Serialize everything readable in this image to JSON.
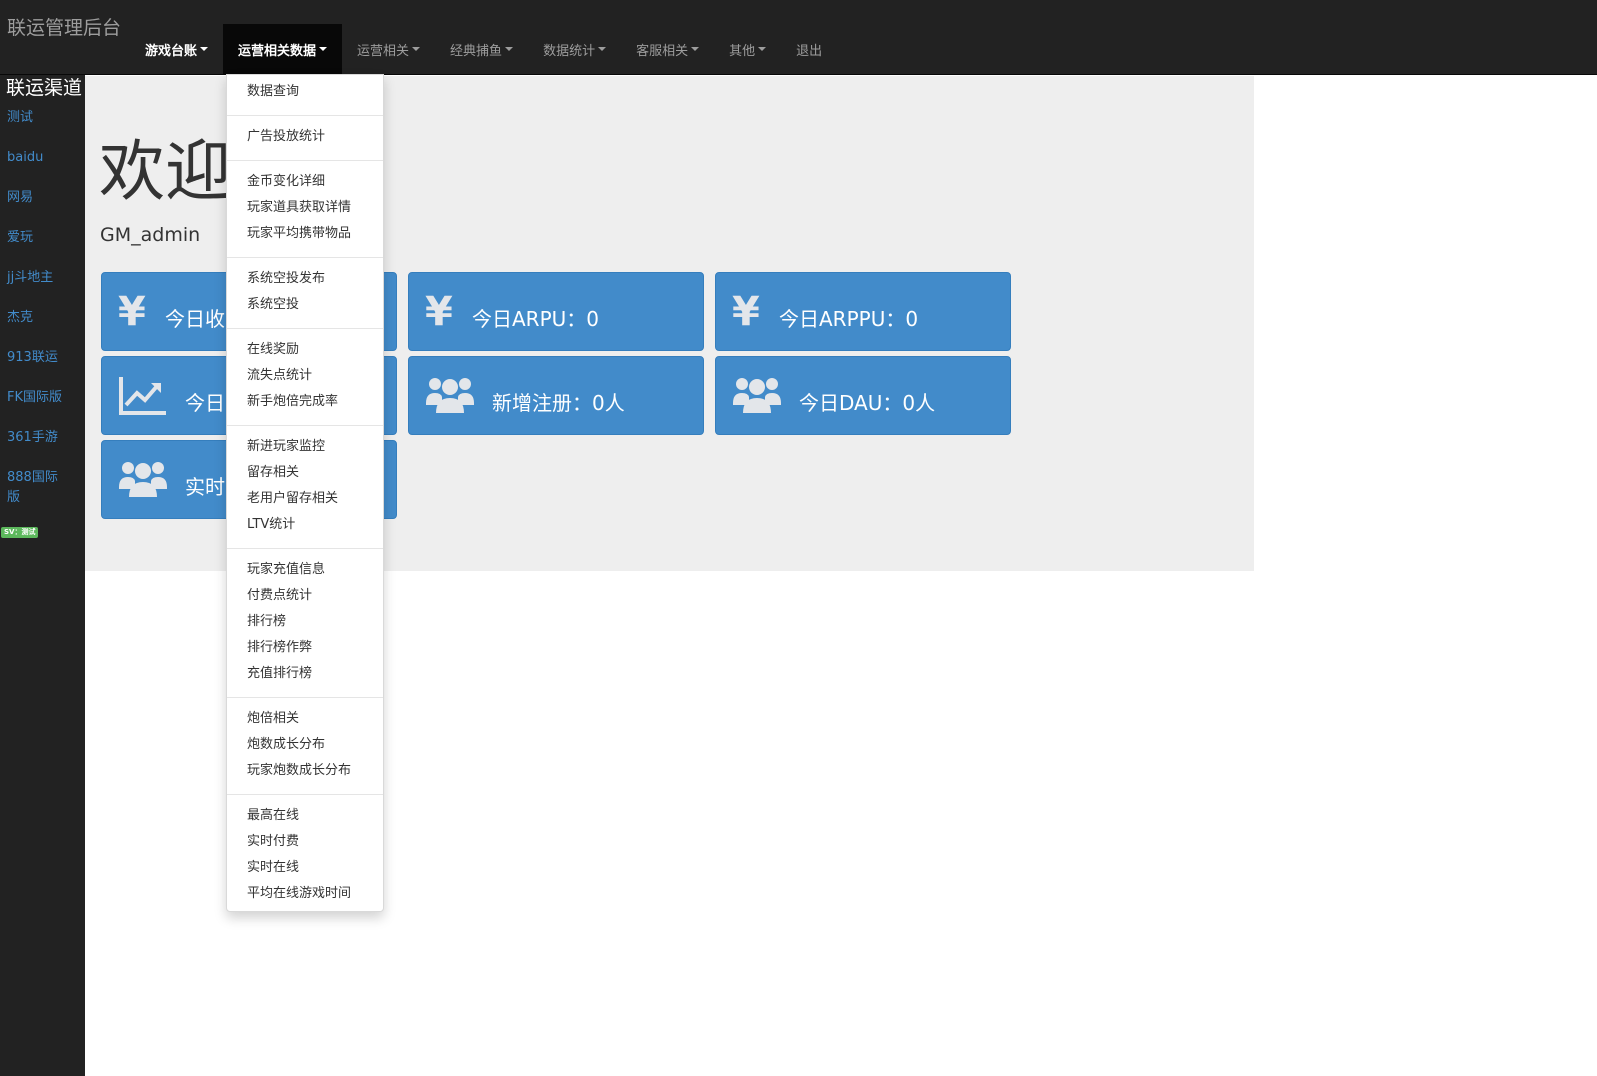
{
  "app": {
    "brand": "联运管理后台"
  },
  "navbar": {
    "items": [
      {
        "label": "游戏台账"
      },
      {
        "label": "运营相关数据"
      },
      {
        "label": "运营相关"
      },
      {
        "label": "经典捕鱼"
      },
      {
        "label": "数据统计"
      },
      {
        "label": "客服相关"
      },
      {
        "label": "其他"
      },
      {
        "label": "退出"
      }
    ]
  },
  "sidebar": {
    "title": "联运渠道",
    "items": [
      {
        "label": "测试"
      },
      {
        "label": "baidu"
      },
      {
        "label": "网易"
      },
      {
        "label": "爱玩"
      },
      {
        "label": "jj斗地主"
      },
      {
        "label": "杰克"
      },
      {
        "label": "913联运"
      },
      {
        "label": "FK国际版"
      },
      {
        "label": "361手游"
      },
      {
        "label": "888国际版"
      }
    ],
    "badge": "SV：测试"
  },
  "main": {
    "welcome": "欢迎",
    "username": "GM_admin",
    "cards": [
      {
        "label": "今日收",
        "icon": "yen-icon"
      },
      {
        "label": "今日ARPU：0",
        "icon": "yen-icon"
      },
      {
        "label": "今日ARPPU：0",
        "icon": "yen-icon"
      },
      {
        "label": "今日",
        "icon": "line-chart-icon"
      },
      {
        "label": "新增注册：0人",
        "icon": "users-icon"
      },
      {
        "label": "今日DAU：0人",
        "icon": "users-icon"
      },
      {
        "label": "实时",
        "icon": "users-icon"
      }
    ]
  },
  "dropdown": {
    "groups": [
      [
        "数据查询"
      ],
      [
        "广告投放统计"
      ],
      [
        "金币变化详细",
        "玩家道具获取详情",
        "玩家平均携带物品"
      ],
      [
        "系统空投发布",
        "系统空投"
      ],
      [
        "在线奖励",
        "流失点统计",
        "新手炮倍完成率"
      ],
      [
        "新进玩家监控",
        "留存相关",
        "老用户留存相关",
        "LTV统计"
      ],
      [
        "玩家充值信息",
        "付费点统计",
        "排行榜",
        "排行榜作弊",
        "充值排行榜"
      ],
      [
        "炮倍相关",
        "炮数成长分布",
        "玩家炮数成长分布"
      ],
      [
        "最高在线",
        "实时付费",
        "实时在线",
        "平均在线游戏时间"
      ]
    ]
  },
  "colors": {
    "navbar_bg": "#222222",
    "card_bg": "#428bca",
    "link": "#428bca",
    "badge": "#5cb85c"
  }
}
